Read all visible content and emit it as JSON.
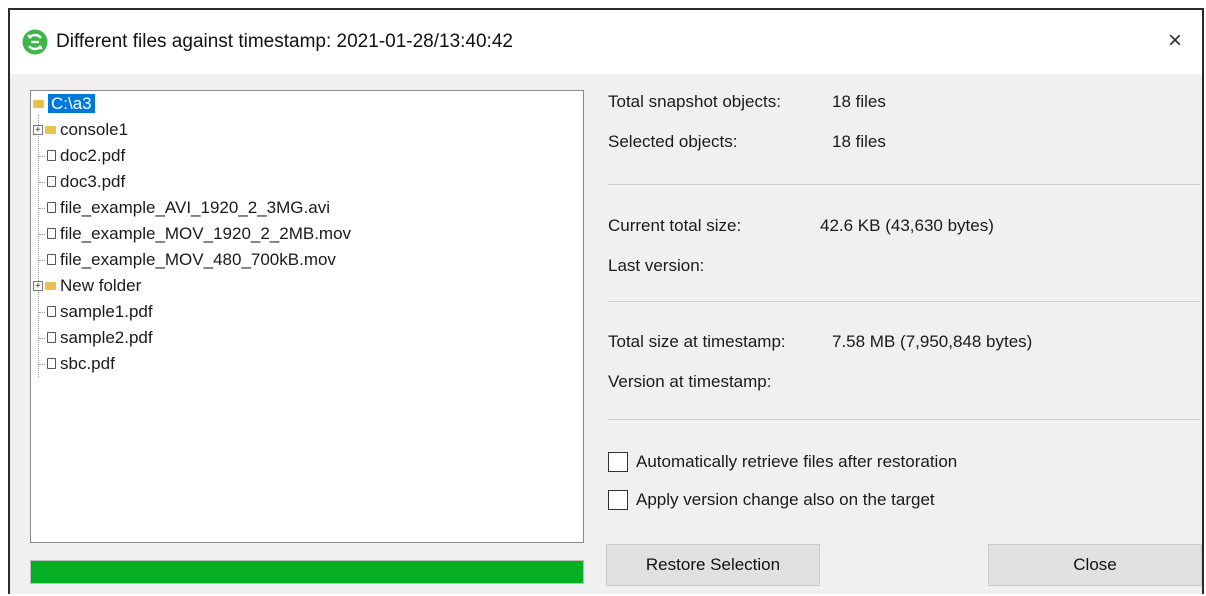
{
  "window": {
    "title": "Different files against timestamp: 2021-01-28/13:40:42",
    "close_glyph": "×",
    "app_icon": "app-logo-icon"
  },
  "tree": {
    "root": "C:\\a3",
    "items": [
      {
        "label": "console1",
        "type": "folder",
        "expandable": true
      },
      {
        "label": "doc2.pdf",
        "type": "file"
      },
      {
        "label": "doc3.pdf",
        "type": "file"
      },
      {
        "label": "file_example_AVI_1920_2_3MG.avi",
        "type": "file"
      },
      {
        "label": "file_example_MOV_1920_2_2MB.mov",
        "type": "file"
      },
      {
        "label": "file_example_MOV_480_700kB.mov",
        "type": "file"
      },
      {
        "label": "New folder",
        "type": "folder",
        "expandable": true
      },
      {
        "label": "sample1.pdf",
        "type": "file"
      },
      {
        "label": "sample2.pdf",
        "type": "file"
      },
      {
        "label": "sbc.pdf",
        "type": "file"
      }
    ],
    "expander_glyph": "+"
  },
  "progress": {
    "fraction": 1.0,
    "color": "#06b025"
  },
  "info": {
    "total_snapshot_label": "Total snapshot objects:",
    "total_snapshot_value": "18 files",
    "selected_label": "Selected objects:",
    "selected_value": "18 files",
    "current_size_label": "Current total size:",
    "current_size_value": "42.6 KB (43,630 bytes)",
    "last_version_label": "Last version:",
    "timestamp_size_label": "Total size at timestamp:",
    "timestamp_size_value": "7.58 MB (7,950,848 bytes)",
    "version_at_timestamp_label": "Version at timestamp:"
  },
  "options": {
    "auto_retrieve": {
      "label": "Automatically retrieve files after restoration",
      "checked": false
    },
    "apply_version": {
      "label": "Apply version change also on the target",
      "checked": false
    }
  },
  "buttons": {
    "restore": "Restore Selection",
    "close": "Close"
  }
}
